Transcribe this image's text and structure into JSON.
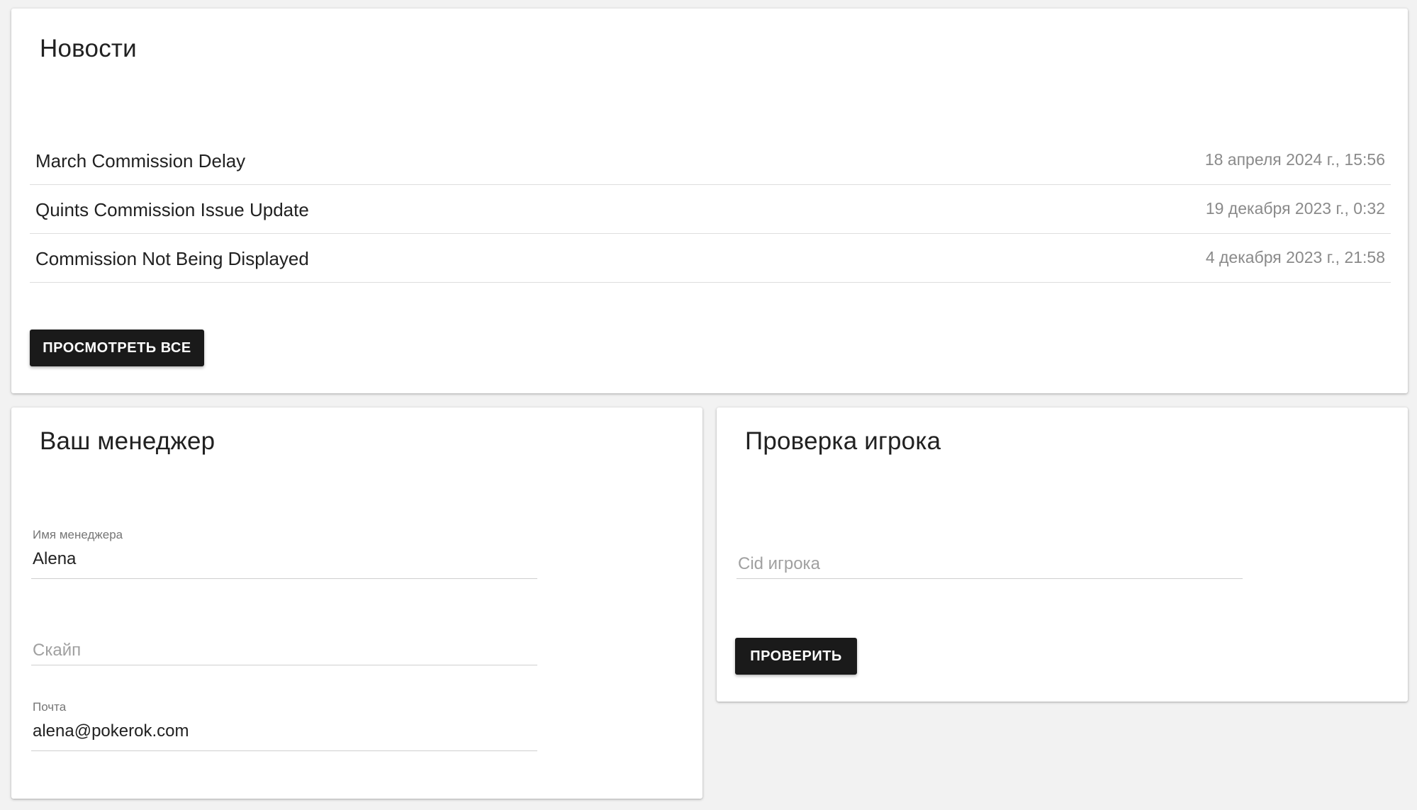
{
  "news": {
    "title": "Новости",
    "items": [
      {
        "title": "March Commission Delay",
        "date": "18 апреля 2024 г., 15:56"
      },
      {
        "title": "Quints Commission Issue Update",
        "date": "19 декабря 2023 г., 0:32"
      },
      {
        "title": "Commission Not Being Displayed",
        "date": "4 декабря 2023 г., 21:58"
      }
    ],
    "view_all_label": "ПРОСМОТРЕТЬ ВСЕ"
  },
  "manager": {
    "title": "Ваш менеджер",
    "name_label": "Имя менеджера",
    "name_value": "Alena",
    "skype_placeholder": "Скайп",
    "email_label": "Почта",
    "email_value": "alena@pokerok.com"
  },
  "player_check": {
    "title": "Проверка игрока",
    "cid_placeholder": "Cid игрока",
    "check_label": "ПРОВЕРИТЬ"
  },
  "colors": {
    "background": "#f2f2f2",
    "card": "#ffffff",
    "button": "#1a1a1a",
    "date_text": "#8a8a8a"
  }
}
